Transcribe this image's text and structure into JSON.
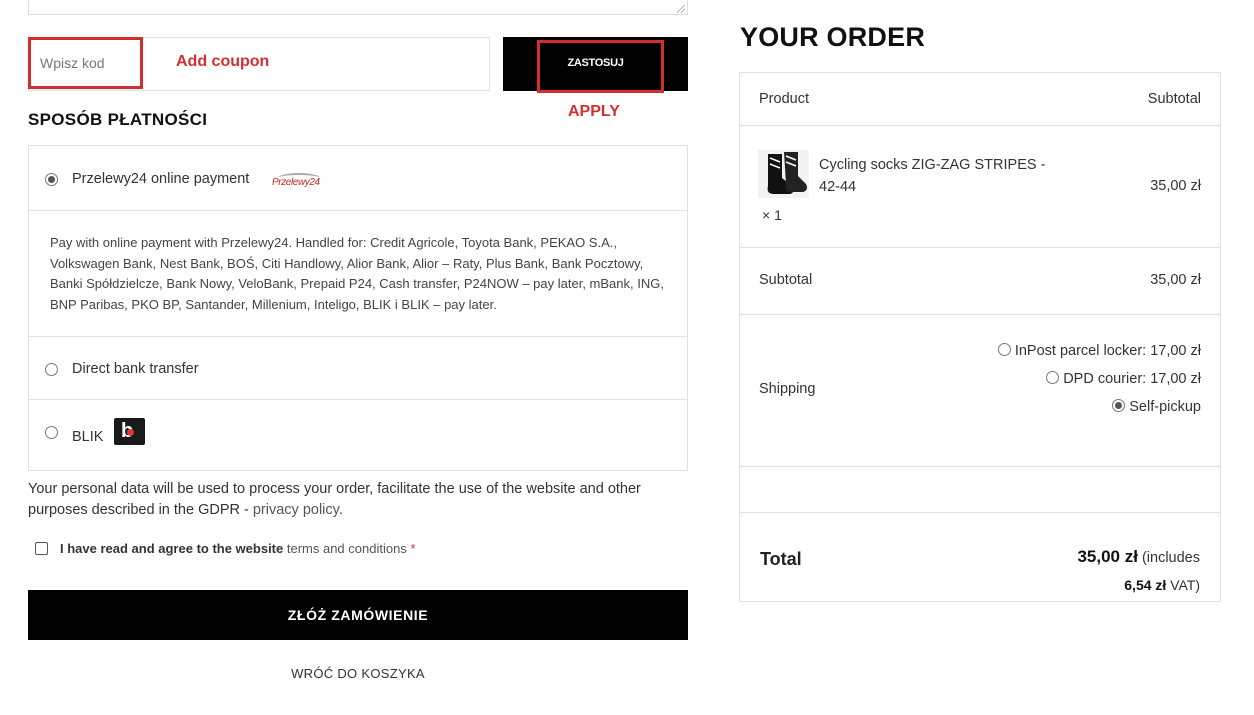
{
  "coupon": {
    "placeholder": "Wpisz kod",
    "annotation": "Add coupon",
    "apply_label": "ZASTOSUJ",
    "apply_annotation": "APPLY"
  },
  "payment": {
    "section_title": "SPOSÓB PŁATNOŚCI",
    "methods": [
      {
        "label": "Przelewy24 online payment",
        "selected": true,
        "logo_text": "Przelewy24",
        "description": "Pay with online payment with Przelewy24. Handled for: Credit Agricole, Toyota Bank, PEKAO S.A., Volkswagen Bank, Nest Bank, BOŚ, Citi Handlowy, Alior Bank, Alior – Raty, Plus Bank, Bank Pocztowy, Banki Spółdzielcze, Bank Nowy, VeloBank, Prepaid P24, Cash transfer, P24NOW – pay later, mBank, ING, BNP Paribas, PKO BP, Santander, Millenium, Inteligo, BLIK i BLIK – pay later."
      },
      {
        "label": "Direct bank transfer",
        "selected": false
      },
      {
        "label": "BLIK",
        "selected": false
      }
    ]
  },
  "privacy": {
    "text": "Your personal data will be used to process your order, facilitate the use of the website and other purposes described in the GDPR - ",
    "link": "privacy policy",
    "end": "."
  },
  "terms": {
    "text": "I have read and agree to the website ",
    "link": "terms and conditions",
    "required": "*"
  },
  "place_order_label": "ZŁÓŻ ZAMÓWIENIE",
  "back_link_label": "WRÓĆ DO KOSZYKA",
  "order": {
    "title": "YOUR ORDER",
    "header_product": "Product",
    "header_subtotal": "Subtotal",
    "item": {
      "name": "Cycling socks ZIG-ZAG STRIPES - 42-44",
      "qty": "× 1",
      "price": "35,00 zł"
    },
    "subtotal_label": "Subtotal",
    "subtotal_value": "35,00 zł",
    "shipping_label": "Shipping",
    "shipping_options": [
      {
        "label": "InPost parcel locker: 17,00 zł",
        "selected": false
      },
      {
        "label": "DPD courier: 17,00 zł",
        "selected": false
      },
      {
        "label": "Self-pickup",
        "selected": true
      }
    ],
    "total_label": "Total",
    "total_value": "35,00 zł",
    "total_includes": " (includes",
    "vat_value": "6,54 zł",
    "vat_suffix": " VAT)"
  },
  "colors": {
    "annotation_red": "#d32f2f",
    "button_black": "#000000",
    "border_gray": "#e2e2e2"
  }
}
